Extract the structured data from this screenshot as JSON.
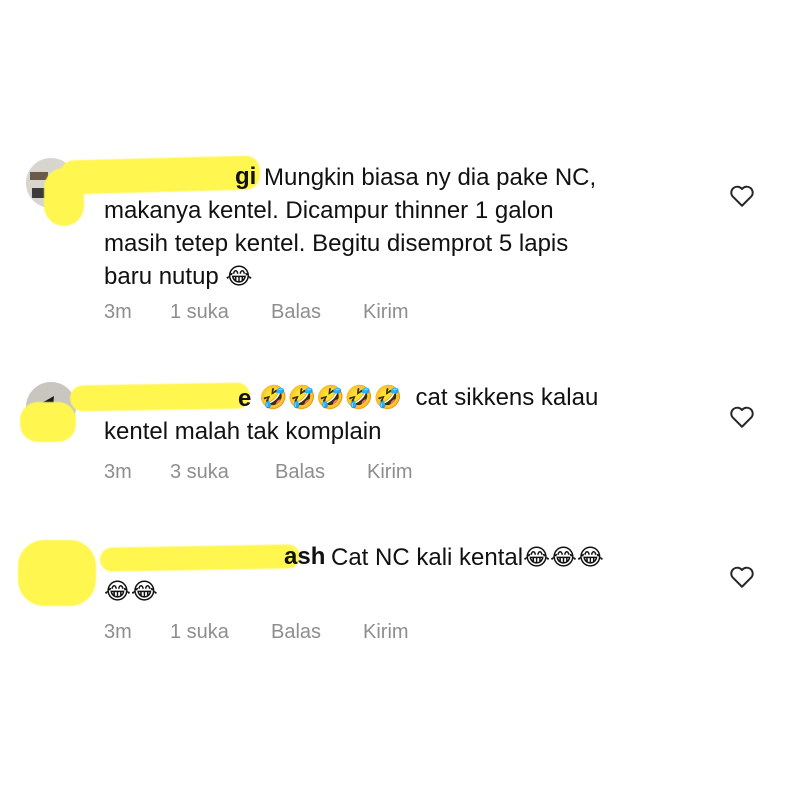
{
  "comments": [
    {
      "name_fragment": "gi",
      "lines": [
        "Mungkin biasa ny  dia pake NC,",
        "makanya kentel. Dicampur thinner 1 galon",
        "masih tetep kentel. Begitu disemprot 5 lapis",
        "baru nutup"
      ],
      "trailing_emoji": "😂",
      "time": "3m",
      "likes": "1 suka",
      "reply": "Balas",
      "send": "Kirim",
      "like_icon": "heart-outline-icon"
    },
    {
      "name_fragment": "e",
      "emojis": "🤣🤣🤣🤣🤣",
      "line1_text": "cat sikkens kalau",
      "line2": "kentel malah tak komplain",
      "time": "3m",
      "likes": "3 suka",
      "reply": "Balas",
      "send": "Kirim",
      "like_icon": "heart-outline-icon"
    },
    {
      "name_fragment": "ash",
      "line1_text": "Cat NC kali  kental",
      "line1_emojis": "😂😂😂",
      "line2_emojis": "😂😂",
      "time": "3m",
      "likes": "1 suka",
      "reply": "Balas",
      "send": "Kirim",
      "like_icon": "heart-outline-icon"
    }
  ],
  "colors": {
    "redaction": "#fff650",
    "meta_text": "#8e8e8e",
    "text": "#111111"
  }
}
